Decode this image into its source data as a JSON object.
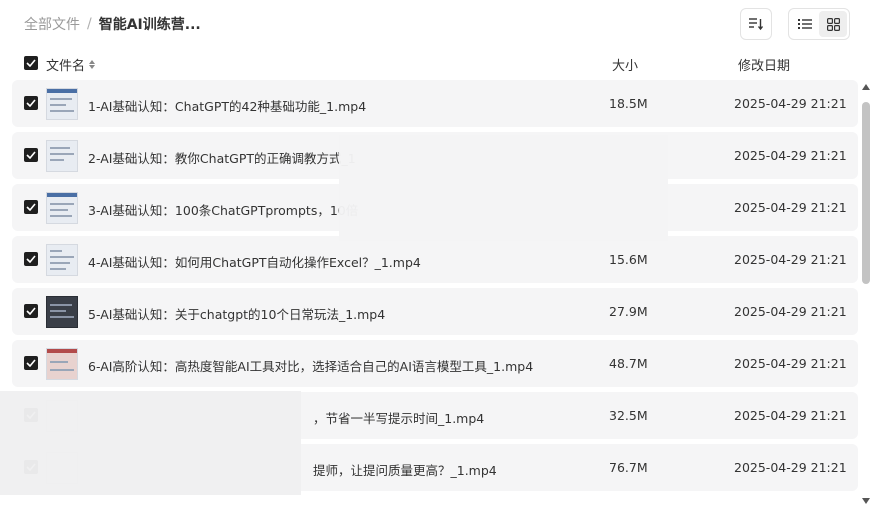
{
  "breadcrumb": {
    "root": "全部文件",
    "separator": "/",
    "current": "智能AI训练营..."
  },
  "toolbar": {
    "sort_icon": "sort-descending-icon",
    "view_list_icon": "list-view-icon",
    "view_grid_icon": "grid-view-icon",
    "active_view": "grid"
  },
  "columns": {
    "name": "文件名",
    "size": "大小",
    "date": "修改日期"
  },
  "files": [
    {
      "name": "1-AI基础认知：ChatGPT的42种基础功能_1.mp4",
      "size": "18.5M",
      "date": "2025-04-29 21:21",
      "checked": true
    },
    {
      "name": "2-AI基础认知：教你ChatGPT的正确调教方式_1",
      "size": "",
      "date": "2025-04-29 21:21",
      "checked": true
    },
    {
      "name": "3-AI基础认知：100条ChatGPTprompts，10倍",
      "size": "",
      "date": "2025-04-29 21:21",
      "checked": true
    },
    {
      "name": "4-AI基础认知：如何用ChatGPT自动化操作Excel？_1.mp4",
      "size": "15.6M",
      "date": "2025-04-29 21:21",
      "checked": true
    },
    {
      "name": "5-AI基础认知：关于chatgpt的10个日常玩法_1.mp4",
      "size": "27.9M",
      "date": "2025-04-29 21:21",
      "checked": true
    },
    {
      "name": "6-AI高阶认知：高热度智能AI工具对比，选择适合自己的AI语言模型工具_1.mp4",
      "size": "48.7M",
      "date": "2025-04-29 21:21",
      "checked": true
    },
    {
      "name": "，节省一半写提示时间_1.mp4",
      "size": "32.5M",
      "date": "2025-04-29 21:21",
      "checked": true
    },
    {
      "name": "提师，让提问质量更高？_1.mp4",
      "size": "76.7M",
      "date": "2025-04-29 21:21",
      "checked": true
    }
  ],
  "colors": {
    "row_background": "#f5f5f6",
    "checkbox": "#1f1f1f",
    "text": "#333333",
    "muted": "#9a9a9a"
  }
}
